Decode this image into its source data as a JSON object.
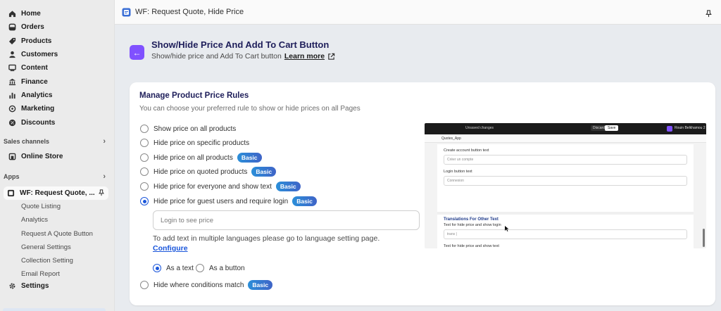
{
  "sidebar": {
    "items": [
      {
        "label": "Home",
        "icon": "home-icon"
      },
      {
        "label": "Orders",
        "icon": "orders-icon"
      },
      {
        "label": "Products",
        "icon": "tag-icon"
      },
      {
        "label": "Customers",
        "icon": "person-icon"
      },
      {
        "label": "Content",
        "icon": "content-icon"
      },
      {
        "label": "Finance",
        "icon": "bank-icon"
      },
      {
        "label": "Analytics",
        "icon": "bar-chart-icon"
      },
      {
        "label": "Marketing",
        "icon": "target-icon"
      },
      {
        "label": "Discounts",
        "icon": "discount-icon"
      }
    ],
    "sales_channels_label": "Sales channels",
    "online_store_label": "Online Store",
    "apps_label": "Apps",
    "app_name": "WF: Request Quote, ...",
    "app_subitems": [
      "Quote Listing",
      "Analytics",
      "Request A Quote Button",
      "General Settings",
      "Collection Setting",
      "Email Report"
    ],
    "settings_label": "Settings"
  },
  "topbar": {
    "title": "WF: Request Quote, Hide Price"
  },
  "header": {
    "title": "Show/Hide Price And Add To Cart Button",
    "subtitle": "Show/hide price and Add To Cart button",
    "learn_more": "Learn more"
  },
  "card": {
    "title": "Manage Product Price Rules",
    "subtitle": "You can choose your preferred rule to show or hide prices on all Pages",
    "options": [
      {
        "label": "Show price on all products",
        "badge": "",
        "selected": false
      },
      {
        "label": "Hide price on specific products",
        "badge": "",
        "selected": false
      },
      {
        "label": "Hide price on all products",
        "badge": "Basic",
        "selected": false
      },
      {
        "label": "Hide price on quoted products",
        "badge": "Basic",
        "selected": false
      },
      {
        "label": "Hide price for everyone and show text",
        "badge": "Basic",
        "selected": false
      },
      {
        "label": "Hide price for guest users and require login",
        "badge": "Basic",
        "selected": true
      }
    ],
    "guest_input_value": "Login to see price",
    "lang_note": "To add text in multiple languages please go to language setting page.",
    "configure_label": "Configure",
    "display_options": [
      {
        "label": "As a text",
        "selected": true
      },
      {
        "label": "As a button",
        "selected": false
      }
    ],
    "last_option": {
      "label": "Hide where conditions match",
      "badge": "Basic",
      "selected": false
    }
  },
  "preview": {
    "unsaved": "Unsaved changes",
    "discard": "Discard",
    "save": "Save",
    "user": "Rouin Belkhamou 2",
    "app_bar": "Quotes_App",
    "field1_label": "Create account button text",
    "field1_value": "Créer un compte",
    "field2_label": "Login button text",
    "field2_value": "Connexion",
    "section_title": "Translations For Other Text",
    "field3_label": "Text for hide price and show login",
    "field3_value": "trans |",
    "field4_label": "Text for hide price and show text"
  },
  "colors": {
    "accent": "#8051ff",
    "title": "#1e1e5a",
    "link": "#1a56db",
    "badge_start": "#2b8fd9",
    "badge_end": "#3f64c7"
  }
}
